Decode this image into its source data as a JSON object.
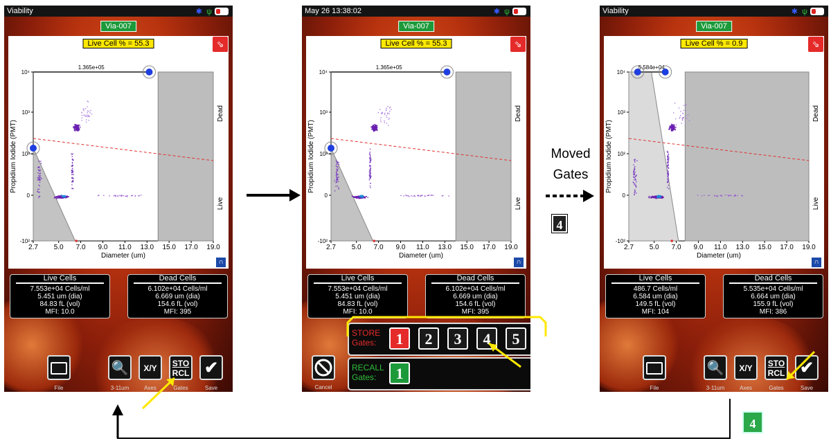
{
  "screens": [
    {
      "status_title": "Viability",
      "via_tag": "Via-007",
      "live_pct": "Live Cell % = 55.3",
      "gate_width_label": "1.365e+05",
      "y_axis_label": "Propidium Iodide (PMT)",
      "x_axis_label": "Diameter (um)",
      "dead_label": "Dead",
      "live_label": "Live",
      "x_ticks": [
        "2.7",
        "5.0",
        "7.0",
        "9.0",
        "11.0",
        "13.0",
        "15.0",
        "17.0",
        "19.0"
      ],
      "live": {
        "title": "Live Cells",
        "conc": "7.553e+04 Cells/ml",
        "dia": "5.451 um (dia)",
        "vol": "84.83 fL (vol)",
        "mfi_label": "MFI:",
        "mfi": "10.0"
      },
      "dead": {
        "title": "Dead Cells",
        "conc": "6.102e+04 Cells/ml",
        "dia": "6.669 um (dia)",
        "vol": "154.6 fL (vol)",
        "mfi_label": "MFI:",
        "mfi": "395"
      },
      "toolbar": {
        "file": "File",
        "zoom": "3-11um",
        "axes": "Axes",
        "gates": "Gates",
        "save": "Save",
        "axes_btn": "X/Y",
        "sto": "STO",
        "rcl": "RCL"
      }
    },
    {
      "status_title": "May 26 13:38:02",
      "via_tag": "Via-007",
      "live_pct": "Live Cell % = 55.3",
      "gate_width_label": "1.365e+05",
      "y_axis_label": "Propidium Iodide (PMT)",
      "x_axis_label": "Diameter (um)",
      "dead_label": "Dead",
      "live_label": "Live",
      "x_ticks": [
        "2.7",
        "5.0",
        "7.0",
        "9.0",
        "11.0",
        "13.0",
        "15.0",
        "17.0",
        "19.0"
      ],
      "live": {
        "title": "Live Cells",
        "conc": "7.553e+04 Cells/ml",
        "dia": "5.451 um (dia)",
        "vol": "84.83 fL (vol)",
        "mfi_label": "MFI:",
        "mfi": "10.0"
      },
      "dead": {
        "title": "Dead Cells",
        "conc": "6.102e+04 Cells/ml",
        "dia": "6.669 um (dia)",
        "vol": "154.6 fL (vol)",
        "mfi_label": "MFI:",
        "mfi": "395"
      },
      "store_label": "STORE Gates:",
      "recall_label": "RECALL Gates:",
      "store_slots": [
        "1",
        "2",
        "3",
        "4",
        "5"
      ],
      "recall_slots": [
        "1"
      ],
      "cancel_label": "Cancel"
    },
    {
      "status_title": "Viability",
      "via_tag": "Via-007",
      "live_pct": "Live Cell % = 0.9",
      "gate_width_label": "5.584e+04",
      "y_axis_label": "Propidium Iodide (PMT)",
      "x_axis_label": "Diameter (um)",
      "dead_label": "Dead",
      "live_label": "Live",
      "x_ticks": [
        "2.7",
        "5.0",
        "7.0",
        "9.0",
        "11.0",
        "13.0",
        "15.0",
        "17.0",
        "19.0"
      ],
      "live": {
        "title": "Live Cells",
        "conc": "486.7 Cells/ml",
        "dia": "6.584 um (dia)",
        "vol": "149.5 fL (vol)",
        "mfi_label": "MFI:",
        "mfi": "104"
      },
      "dead": {
        "title": "Dead Cells",
        "conc": "5.535e+04 Cells/ml",
        "dia": "6.664 um (dia)",
        "vol": "155.9 fL (vol)",
        "mfi_label": "MFI:",
        "mfi": "386"
      },
      "toolbar": {
        "file": "File",
        "zoom": "3-11um",
        "axes": "Axes",
        "gates": "Gates",
        "save": "Save",
        "axes_btn": "X/Y",
        "sto": "STO",
        "rcl": "RCL"
      }
    }
  ],
  "annotations": {
    "moved_gates": "Moved Gates",
    "store_slot_number": "4",
    "recall_slot_number": "4"
  },
  "colors": {
    "via_green": "#1c9a3a",
    "live_yellow": "#ffe800",
    "store_red": "#e52a2a",
    "gate_gray": "#bdbdbd",
    "event_purple": "#6a1fb0"
  },
  "y_ticks": [
    "10⁴",
    "10³",
    "10²",
    "0",
    "-10²"
  ]
}
